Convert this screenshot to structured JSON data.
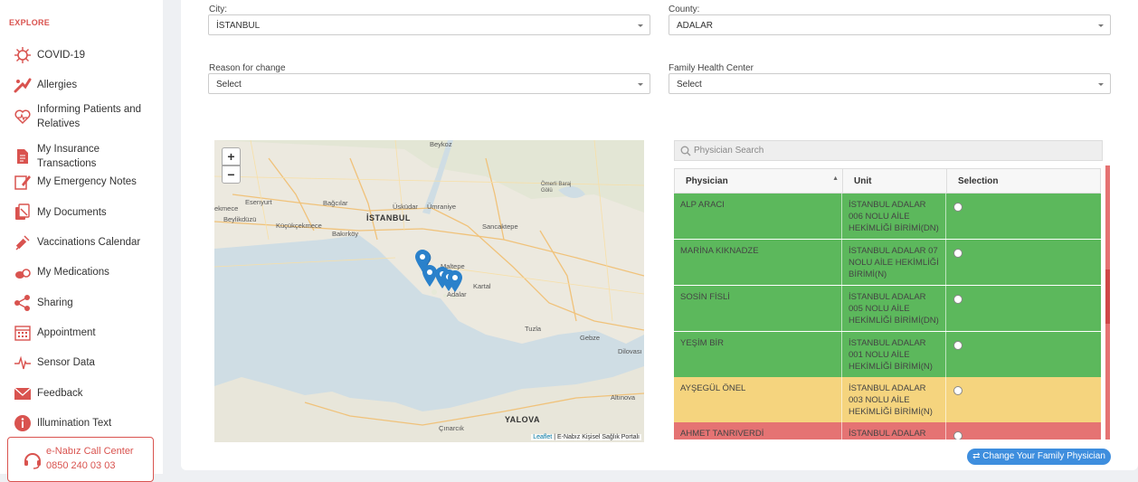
{
  "sidebar": {
    "section_title": "EXPLORE",
    "items": [
      {
        "label": "COVID-19",
        "icon": "virus-icon"
      },
      {
        "label": "Allergies",
        "icon": "allergy-icon"
      },
      {
        "label": "Informing Patients and Relatives",
        "icon": "heart-info-icon"
      },
      {
        "label": "My Insurance Transactions",
        "icon": "insurance-doc-icon"
      },
      {
        "label": "My Emergency Notes",
        "icon": "note-pen-icon"
      },
      {
        "label": "My Documents",
        "icon": "documents-icon"
      },
      {
        "label": "Vaccinations Calendar",
        "icon": "syringe-icon"
      },
      {
        "label": "My Medications",
        "icon": "pills-icon"
      },
      {
        "label": "Sharing",
        "icon": "share-icon"
      },
      {
        "label": "Appointment",
        "icon": "calendar-icon"
      },
      {
        "label": "Sensor Data",
        "icon": "pulse-icon"
      },
      {
        "label": "Feedback",
        "icon": "envelope-icon"
      },
      {
        "label": "Illumination Text",
        "icon": "info-icon"
      }
    ],
    "call_center": {
      "title": "e-Nabız Call Center",
      "phone": "0850 240 03 03",
      "icon": "headset-icon"
    }
  },
  "form": {
    "city": {
      "label": "City:",
      "value": "İSTANBUL"
    },
    "county": {
      "label": "County:",
      "value": "ADALAR"
    },
    "reason": {
      "label": "Reason for change",
      "value": "Select"
    },
    "family_center": {
      "label": "Family Health Center",
      "value": "Select"
    }
  },
  "map": {
    "zoom_in": "+",
    "zoom_out": "−",
    "attribution_leaflet": "Leaflet",
    "attribution_rest": " | E-Nabız Kişisel Sağlık Portalı",
    "labels": [
      "Beykoz",
      "Esenyurt",
      "Bağcılar",
      "Üsküdar",
      "Ümraniye",
      "Ömerli Baraj Gölü",
      "Beylikdüzü",
      "Küçükçekmece",
      "İSTANBUL",
      "Sancaktepe",
      "Bakırköy",
      "Maltepe",
      "Adalar",
      "Kartal",
      "Tuzla",
      "Gebze",
      "Dilovası",
      "Altınova",
      "YALOVA",
      "Çınarcık",
      "ekmece"
    ],
    "markers": 5
  },
  "physician_table": {
    "search_placeholder": "Physician Search",
    "columns": [
      "Physician",
      "Unit",
      "Selection"
    ],
    "sort_indicator": "▲",
    "rows": [
      {
        "physician": "ALP ARACI",
        "unit": "İSTANBUL ADALAR 006 NOLU AİLE HEKİMLİĞİ BİRİMİ(DN)",
        "status": "green"
      },
      {
        "physician": "MARİNA KIKNADZE",
        "unit": "İSTANBUL ADALAR 07 NOLU AİLE HEKİMLİĞİ BİRİMİ(N)",
        "status": "green"
      },
      {
        "physician": "SOSİN FİSLİ",
        "unit": "İSTANBUL ADALAR 005 NOLU AİLE HEKİMLİĞİ BİRİMİ(DN)",
        "status": "green"
      },
      {
        "physician": "YEŞİM BİR",
        "unit": "İSTANBUL ADALAR 001 NOLU AİLE HEKİMLİĞİ BİRİMİ(N)",
        "status": "green"
      },
      {
        "physician": "AYŞEGÜL ÖNEL",
        "unit": "İSTANBUL ADALAR 003 NOLU AİLE HEKİMLİĞİ BİRİMİ(N)",
        "status": "yellow"
      },
      {
        "physician": "AHMET TANRIVERDİ",
        "unit": "İSTANBUL ADALAR",
        "status": "red"
      }
    ]
  },
  "colors": {
    "green": "#5cb85c",
    "yellow": "#f5d47e",
    "red": "#e57373",
    "accent": "#d9534f",
    "button": "#3e8ede"
  },
  "change_button": {
    "label": "Change Your Family Physician",
    "icon": "swap-icon"
  }
}
